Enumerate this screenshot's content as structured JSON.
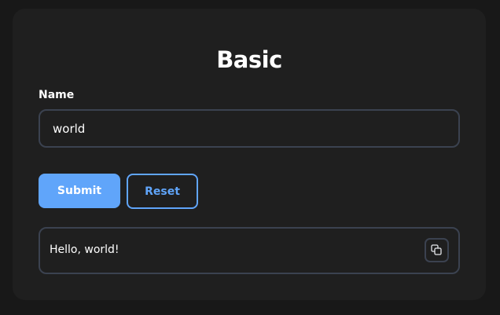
{
  "card": {
    "title": "Basic"
  },
  "form": {
    "name_label": "Name",
    "name_value": "world",
    "submit_label": "Submit",
    "reset_label": "Reset"
  },
  "output": {
    "text": "Hello, world!",
    "copy_icon": "copy-icon"
  },
  "colors": {
    "background": "#181818",
    "card": "#1f1f1f",
    "accent": "#60a5fa",
    "border": "#3b4250",
    "text": "#ffffff"
  }
}
